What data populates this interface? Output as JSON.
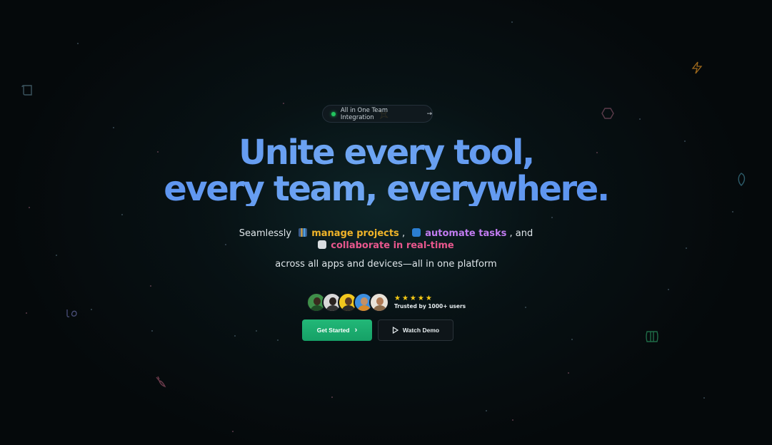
{
  "badge": {
    "label": "All in One Team Integration",
    "arrow": "→"
  },
  "headline": {
    "line1": "Unite every tool,",
    "line2": "every team, everywhere."
  },
  "subtitle": {
    "lead": "Seamlessly",
    "item1": "manage projects",
    "sep1": ",",
    "item2": "automate tasks",
    "sep2": ", and",
    "item3": "collaborate in real-time",
    "line3": "across all apps and devices—all in one platform"
  },
  "social_proof": {
    "stars": "★★★★★",
    "trusted": "Trusted by 1000+ users"
  },
  "cta": {
    "primary": "Get Started",
    "primary_arrow": "›",
    "secondary": "Watch Demo"
  },
  "colors": {
    "accent_green": "#22b878",
    "headline_blue": "#5b93f0",
    "yellow": "#f0b429",
    "purple": "#c17bf0",
    "pink": "#e8578d"
  }
}
